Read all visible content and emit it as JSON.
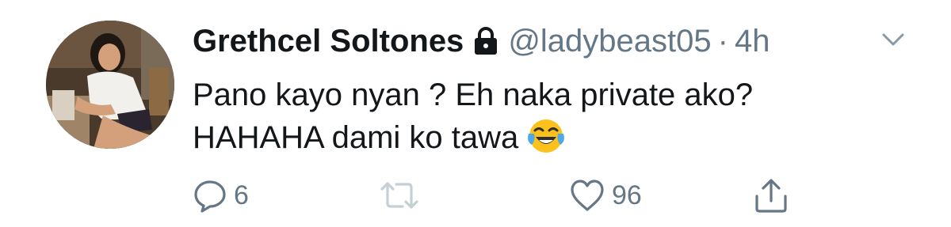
{
  "tweet": {
    "author": {
      "display_name": "Grethcel Soltones",
      "handle": "@ladybeast05",
      "protected_icon": "lock-icon",
      "avatar": "avatar-photo"
    },
    "separator": "·",
    "timestamp": "4h",
    "menu_icon": "chevron-down-icon",
    "text_lines": [
      "Pano kayo nyan ? Eh naka private ako?",
      "HAHAHA dami ko tawa"
    ],
    "emoji": "face-with-tears-of-joy-emoji",
    "actions": {
      "reply": {
        "icon": "reply-icon",
        "count": "6"
      },
      "retweet": {
        "icon": "retweet-icon",
        "count": ""
      },
      "like": {
        "icon": "heart-icon",
        "count": "96"
      },
      "share": {
        "icon": "share-icon",
        "count": ""
      }
    }
  },
  "colors": {
    "text_primary": "#14171a",
    "text_secondary": "#657786",
    "retweet_disabled": "#c4cfd6",
    "emoji_yellow": "#fcc21b",
    "emoji_tears": "#4fa9e8"
  }
}
